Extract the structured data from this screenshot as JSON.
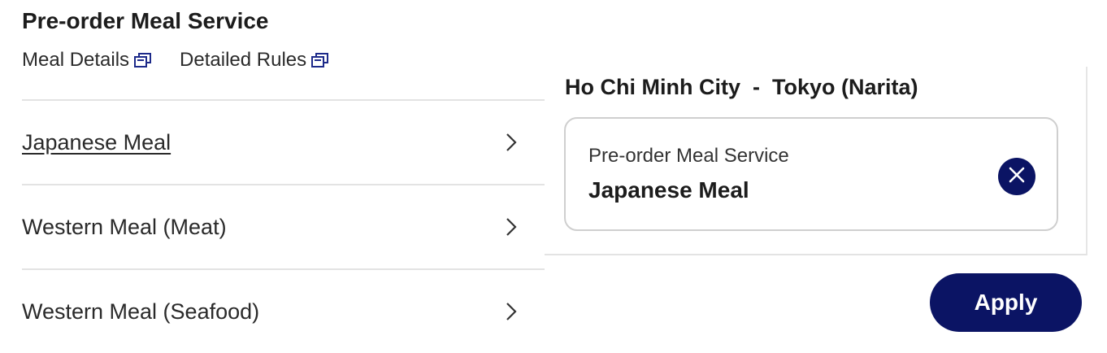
{
  "section": {
    "title": "Pre-order Meal Service",
    "links": [
      {
        "label": "Meal Details",
        "icon": "external-window-icon"
      },
      {
        "label": "Detailed Rules",
        "icon": "external-window-icon"
      }
    ]
  },
  "meals": [
    {
      "label": "Japanese Meal",
      "selected": true
    },
    {
      "label": "Western Meal (Meat)",
      "selected": false
    },
    {
      "label": "Western Meal (Seafood)",
      "selected": false
    }
  ],
  "selection": {
    "route": "Ho Chi Minh City  -  Tokyo (Narita)",
    "caption": "Pre-order Meal Service",
    "value": "Japanese Meal",
    "remove_icon": "close-icon"
  },
  "apply_label": "Apply",
  "colors": {
    "brand_navy": "#0b1464",
    "divider": "#e3e3e3",
    "text": "#222222"
  }
}
